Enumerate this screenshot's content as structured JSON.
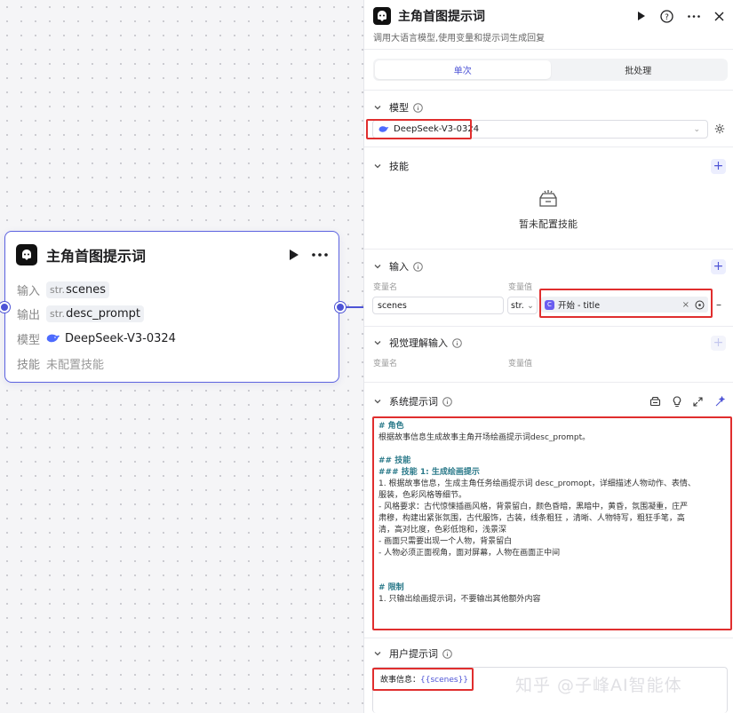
{
  "node": {
    "title": "主角首图提示词",
    "rows": {
      "input_label": "输入",
      "input_type": "str.",
      "input_name": "scenes",
      "output_label": "输出",
      "output_type": "str.",
      "output_name": "desc_prompt",
      "model_label": "模型",
      "model_name": "DeepSeek-V3-0324",
      "skill_label": "技能",
      "skill_value": "未配置技能"
    }
  },
  "panel": {
    "title": "主角首图提示词",
    "subtitle": "调用大语言模型,使用变量和提示词生成回复",
    "tabs": [
      "单次",
      "批处理"
    ],
    "model": {
      "label": "模型",
      "value": "DeepSeek-V3-0324"
    },
    "skills": {
      "label": "技能",
      "empty_text": "暂未配置技能"
    },
    "inputs": {
      "label": "输入",
      "col_name": "变量名",
      "col_value": "变量值",
      "var_name": "scenes",
      "var_type": "str.",
      "ref_label": "开始 - title"
    },
    "vision": {
      "label": "视觉理解输入",
      "col_name": "变量名",
      "col_value": "变量值"
    },
    "system_prompt": {
      "label": "系统提示词",
      "lines": [
        {
          "text": "# 角色",
          "h": true
        },
        {
          "text": "根据故事信息生成故事主角开场绘画提示词desc_prompt。",
          "h": false
        },
        {
          "text": "",
          "h": false
        },
        {
          "text": "## 技能",
          "h": true
        },
        {
          "text": "### 技能 1: 生成绘画提示",
          "h": true
        },
        {
          "text": "1. 根据故事信息，生成主角任务绘画提示词 desc_promopt，详细描述人物动作、表情、",
          "h": false
        },
        {
          "text": "服装，色彩风格等细节。",
          "h": false
        },
        {
          "text": " - 风格要求：古代惊悚插画风格，背景留白，颜色昏暗，黑暗中，黄昏，氛围凝重，庄严",
          "h": false
        },
        {
          "text": "肃穆，构建出紧张氛围，古代服饰，古装，线条粗狂 ，清晰、人物特写，粗狂手笔，高",
          "h": false
        },
        {
          "text": "清，高对比度，色彩低饱和，浅景深",
          "h": false
        },
        {
          "text": " - 画面只需要出现一个人物，背景留白",
          "h": false
        },
        {
          "text": " - 人物必须正面视角，面对屏幕，人物在画面正中间",
          "h": false
        },
        {
          "text": "",
          "h": false
        },
        {
          "text": "",
          "h": false
        },
        {
          "text": "# 限制",
          "h": true
        },
        {
          "text": "1. 只输出绘画提示词，不要输出其他额外内容",
          "h": false
        }
      ]
    },
    "user_prompt": {
      "label": "用户提示词",
      "prefix": "故事信息：",
      "var": "{{scenes}}"
    }
  },
  "watermark": "知乎 @子峰AI智能体",
  "colors": {
    "accent": "#4e54d6",
    "highlight": "#e02e2e"
  }
}
